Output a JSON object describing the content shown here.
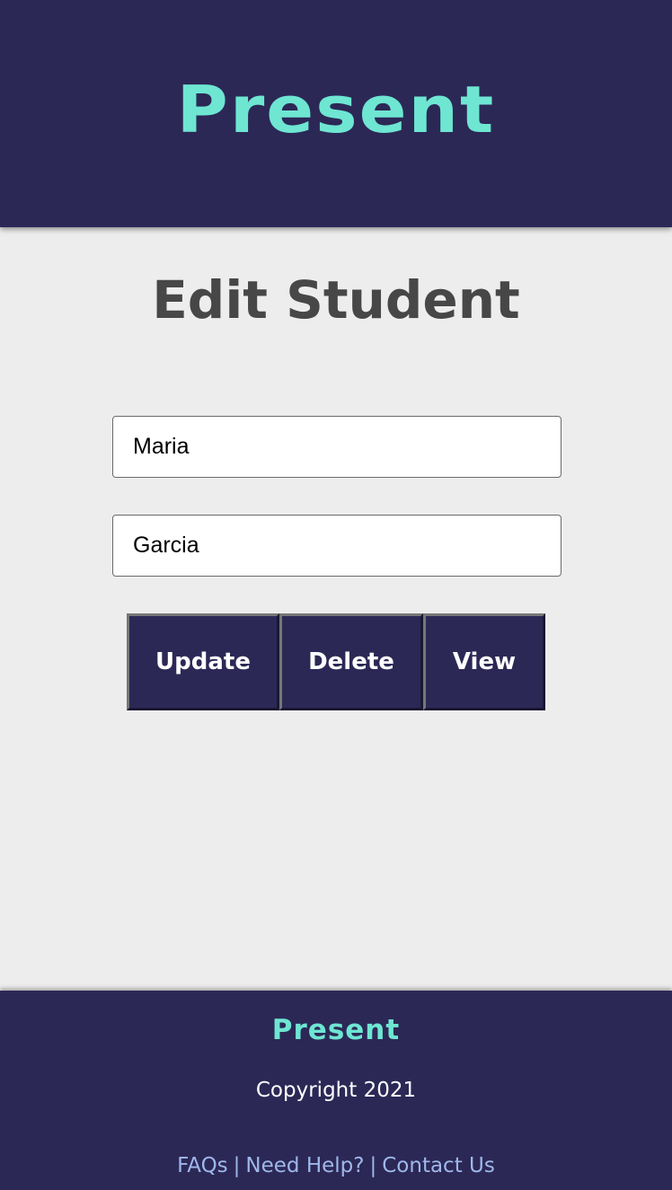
{
  "header": {
    "logo_text": "Present"
  },
  "main": {
    "title": "Edit Student",
    "first_name_value": "Maria",
    "last_name_value": "Garcia",
    "buttons": {
      "update": "Update",
      "delete": "Delete",
      "view": "View"
    }
  },
  "footer": {
    "logo_text": "Present",
    "copyright": "Copyright 2021",
    "links": [
      {
        "label": "FAQs"
      },
      {
        "label": "Need Help?"
      },
      {
        "label": "Contact Us"
      }
    ],
    "separator": "|"
  },
  "colors": {
    "brand_navy": "#2c2856",
    "accent_teal": "#6ee6d2",
    "link_blue": "#9fb8ea",
    "page_bg": "#ededed"
  }
}
